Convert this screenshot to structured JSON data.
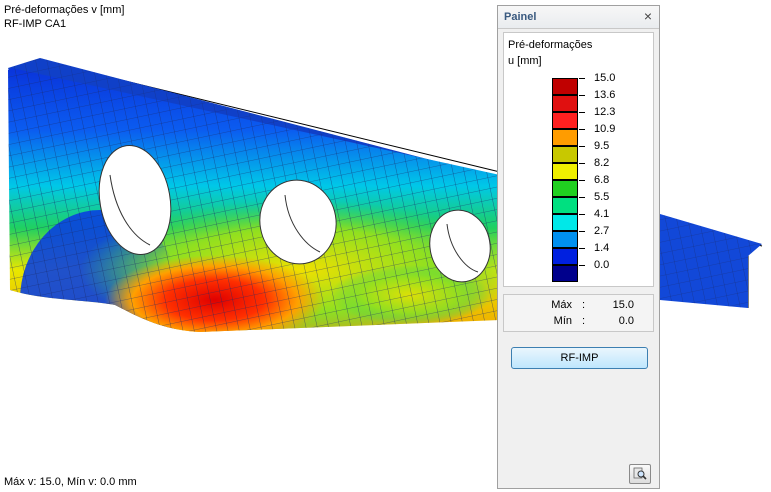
{
  "viewport": {
    "title": "Pré-deformações v [mm]",
    "subtitle": "RF-IMP CA1",
    "status": "Máx v: 15.0, Mín v: 0.0 mm"
  },
  "panel": {
    "title": "Painel",
    "close_icon": "close-icon",
    "legend_title": "Pré-deformações",
    "legend_unit": "u [mm]",
    "legend": [
      {
        "label": "15.0",
        "color": "#c00000"
      },
      {
        "label": "13.6",
        "color": "#e01010"
      },
      {
        "label": "12.3",
        "color": "#ff2020"
      },
      {
        "label": "10.9",
        "color": "#ff9c00"
      },
      {
        "label": "9.5",
        "color": "#c8c800"
      },
      {
        "label": "8.2",
        "color": "#f0f000"
      },
      {
        "label": "6.8",
        "color": "#20d020"
      },
      {
        "label": "5.5",
        "color": "#00e080"
      },
      {
        "label": "4.1",
        "color": "#00e8e8"
      },
      {
        "label": "2.7",
        "color": "#0090f0"
      },
      {
        "label": "1.4",
        "color": "#0020e0"
      },
      {
        "label": "0.0",
        "color": "#00008c"
      }
    ],
    "max_label": "Máx",
    "max_value": "15.0",
    "min_label": "Mín",
    "min_value": "0.0",
    "colon": ":",
    "rfimp_button": "RF-IMP",
    "settings_icon": "magnifier-settings-icon"
  }
}
